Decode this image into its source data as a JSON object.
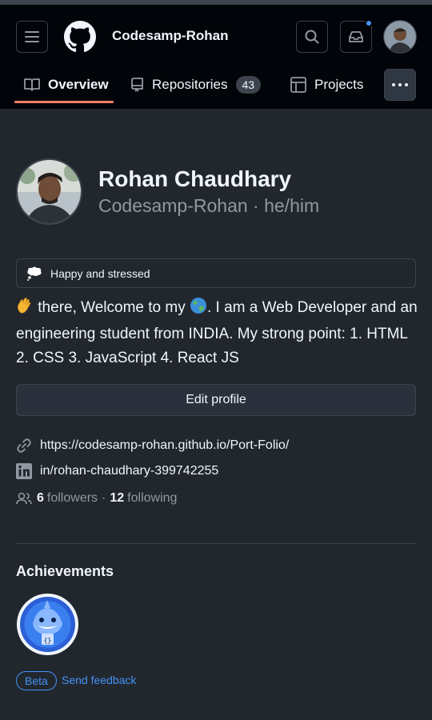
{
  "header": {
    "username": "Codesamp-Rohan",
    "icons": [
      "hamburger-icon",
      "github-logo-icon",
      "search-icon",
      "inbox-icon"
    ],
    "colors": {
      "background": "#010409",
      "notification_dot": "#4493f8"
    }
  },
  "tabs": [
    {
      "label": "Overview",
      "icon": "book-icon",
      "active": true
    },
    {
      "label": "Repositories",
      "icon": "repo-icon",
      "count": "43"
    },
    {
      "label": "Projects",
      "icon": "table-icon"
    }
  ],
  "profile": {
    "name": "Rohan Chaudhary",
    "login_line": "Codesamp-Rohan · he/him",
    "status": "Happy and stressed",
    "bio_part1": " there, Welcome to my ",
    "bio_part2": ". I am a Web Developer and an engineering student from INDIA. My strong point: 1. HTML 2. CSS 3. JavaScript 4. React JS",
    "edit_label": "Edit profile",
    "website": "https://codesamp-rohan.github.io/Port-Folio/",
    "linkedin": "in/rohan-chaudhary-399742255",
    "followers_count": "6",
    "followers_label": "followers",
    "separator": "·",
    "following_count": "12",
    "following_label": "following"
  },
  "achievements": {
    "title": "Achievements",
    "beta_label": "Beta",
    "feedback_label": "Send feedback"
  },
  "colors": {
    "accent_tab": "#f78166",
    "link": "#4493f8",
    "page_bg": "#22272e"
  }
}
